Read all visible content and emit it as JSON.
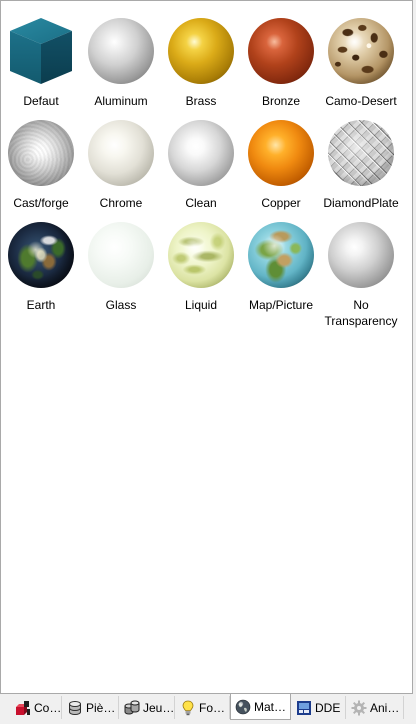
{
  "materials": [
    {
      "label": "Defaut",
      "icon": "teal-cube-icon"
    },
    {
      "label": "Aluminum",
      "icon": "aluminum-sphere-icon"
    },
    {
      "label": "Brass",
      "icon": "brass-sphere-icon"
    },
    {
      "label": "Bronze",
      "icon": "bronze-sphere-icon"
    },
    {
      "label": "Camo-Desert",
      "icon": "camo-desert-sphere-icon"
    },
    {
      "label": "Cast/forge",
      "icon": "cast-forge-sphere-icon"
    },
    {
      "label": "Chrome",
      "icon": "chrome-sphere-icon"
    },
    {
      "label": "Clean",
      "icon": "clean-sphere-icon"
    },
    {
      "label": "Copper",
      "icon": "copper-sphere-icon"
    },
    {
      "label": "DiamondPlate",
      "icon": "diamond-plate-sphere-icon"
    },
    {
      "label": "Earth",
      "icon": "earth-globe-icon"
    },
    {
      "label": "Glass",
      "icon": "glass-sphere-icon"
    },
    {
      "label": "Liquid",
      "icon": "liquid-sphere-icon"
    },
    {
      "label": "Map/Picture",
      "icon": "map-globe-icon"
    },
    {
      "label": "No Transparency",
      "icon": "no-transparency-sphere-icon"
    }
  ],
  "tabs": [
    {
      "label": "Co…",
      "icon": "component-icon",
      "selected": false
    },
    {
      "label": "Piè…",
      "icon": "part-icon",
      "selected": false
    },
    {
      "label": "Jeu…",
      "icon": "configuration-icon",
      "selected": false
    },
    {
      "label": "Fo…",
      "icon": "lightbulb-icon",
      "selected": false
    },
    {
      "label": "Mat…",
      "icon": "globe-icon",
      "selected": true
    },
    {
      "label": "DDE",
      "icon": "dde-icon",
      "selected": false
    },
    {
      "label": "Ani…",
      "icon": "gear-icon",
      "selected": false
    }
  ],
  "colors": {
    "panel_background": "#ffffff",
    "tabstrip_background": "#f0f0f0",
    "selected_tab_background": "#ffffff"
  }
}
